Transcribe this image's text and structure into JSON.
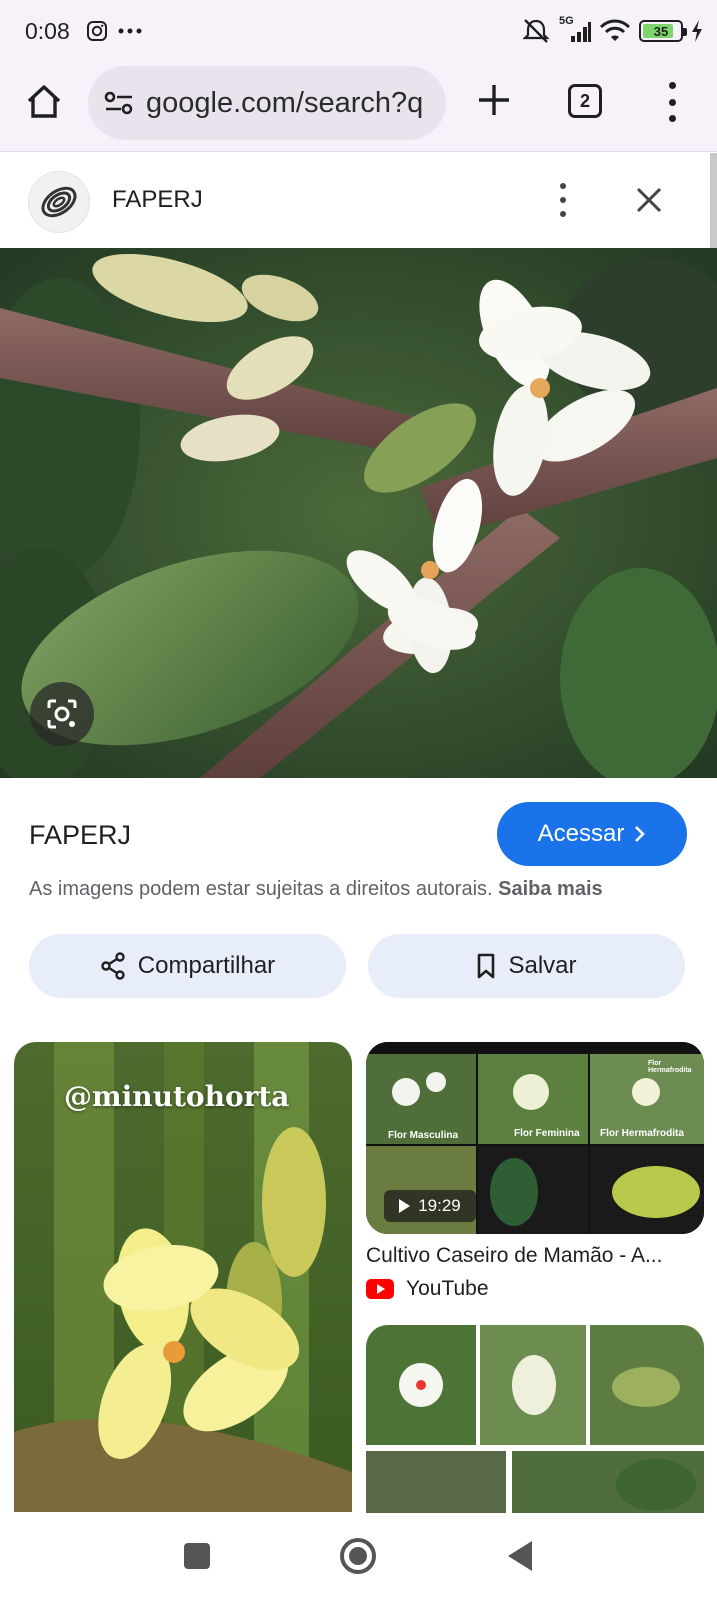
{
  "status_bar": {
    "time": "0:08",
    "network": "5G",
    "battery": "35"
  },
  "browser": {
    "url": "google.com/search?q",
    "tab_count": "2"
  },
  "result": {
    "site_name": "FAPERJ",
    "source_title": "FAPERJ",
    "visit_label": "Acessar",
    "copyright_text": "As imagens podem estar sujeitas a direitos autorais.",
    "learn_more": "Saiba mais",
    "share_label": "Compartilhar",
    "save_label": "Salvar"
  },
  "related": {
    "left_watermark": "@minutohorta",
    "video": {
      "duration": "19:29",
      "title": "Cultivo Caseiro de Mamão - A...",
      "source": "YouTube",
      "collage_labels": [
        "Flor Masculina",
        "Flor Feminina",
        "Flor Hermafrodita",
        "Flor Hermafrodita"
      ]
    }
  },
  "icons": {
    "status": [
      "instagram-icon",
      "more-horiz-icon",
      "silent-icon",
      "signal-icon",
      "wifi-icon",
      "battery-icon",
      "charging-icon"
    ],
    "toolbar": [
      "home-icon",
      "tune-icon",
      "plus-icon",
      "tabs-icon",
      "more-vert-icon"
    ],
    "result": [
      "more-vert-icon",
      "close-icon",
      "lens-icon",
      "chevron-right-icon",
      "share-icon",
      "bookmark-icon",
      "play-icon",
      "youtube-icon"
    ],
    "nav": [
      "recent-apps-icon",
      "home-icon",
      "back-icon"
    ]
  },
  "colors": {
    "accent": "#1a73e8",
    "chip_bg": "#e8eef9",
    "toolbar_bg": "#f7f2fa",
    "url_bg": "#e9e3ee"
  }
}
